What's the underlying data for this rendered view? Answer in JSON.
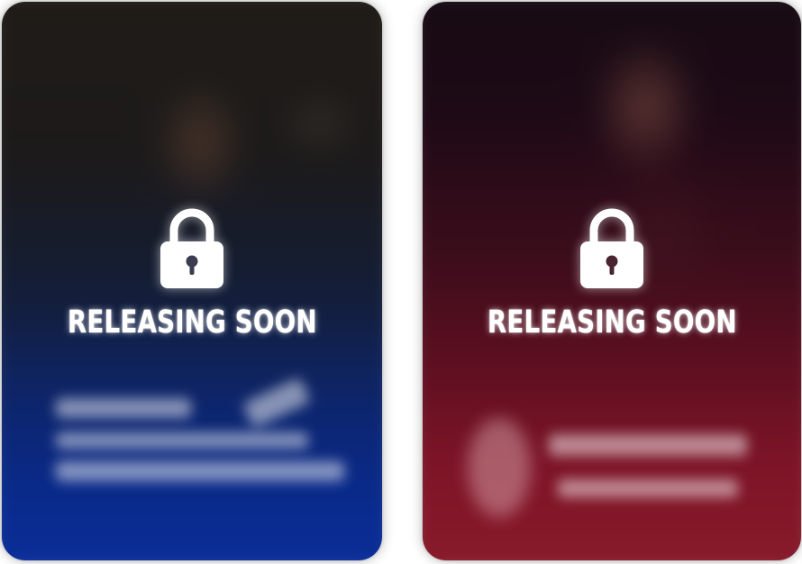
{
  "cards": [
    {
      "status_label": "RELEASING SOON",
      "lock_icon": "lock-icon",
      "theme_color": "#0b2f9c"
    },
    {
      "status_label": "RELEASING SOON",
      "lock_icon": "lock-icon",
      "theme_color": "#8a1b2b"
    }
  ]
}
